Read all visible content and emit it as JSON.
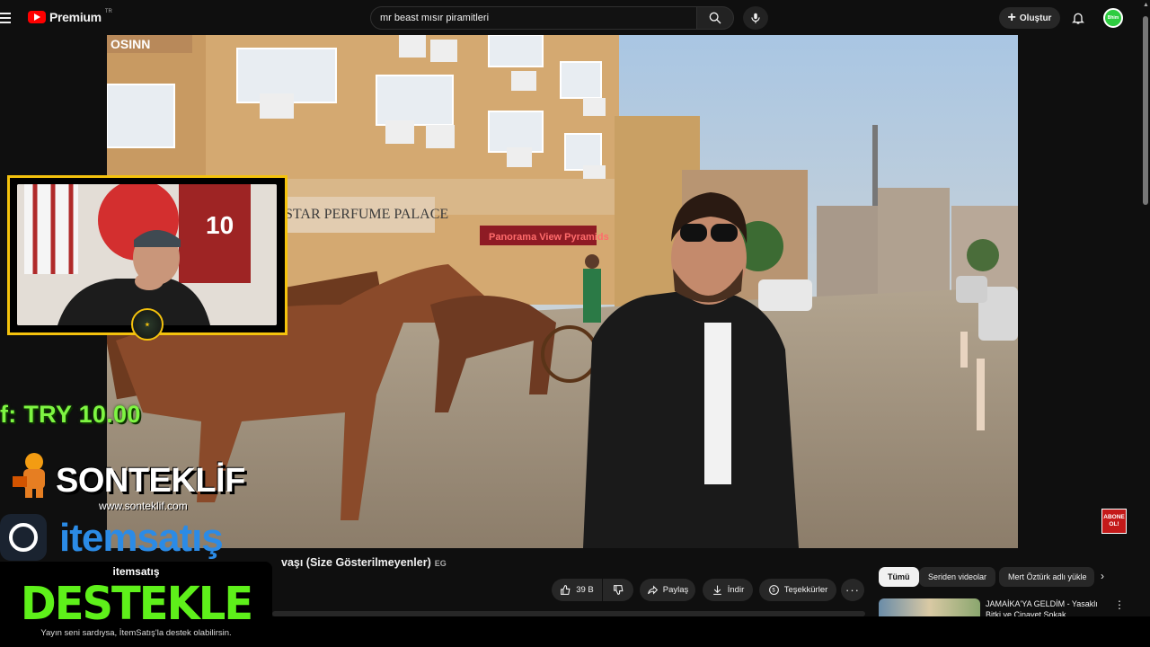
{
  "header": {
    "logo_text": "Premium",
    "logo_region": "TR",
    "search_value": "mr beast mısır piramitleri",
    "create_label": "Oluştur",
    "avatar_text": "Bhim"
  },
  "video": {
    "scene_signs": [
      "OSINN",
      "STAR PERFUME PALACE",
      "Panorama View Pyramids"
    ],
    "title_visible": "vaşı (Size Gösterilmeyenler)",
    "country_tag": "EG",
    "subscribe_badge": "ABONE OL!"
  },
  "actions": {
    "likes": "39 B",
    "share": "Paylaş",
    "download": "İndir",
    "thanks": "Teşekkürler"
  },
  "chips": [
    "Tümü",
    "Seriden videolar",
    "Mert Öztürk adlı yükle"
  ],
  "recommendation": {
    "title": "JAMAİKA'YA GELDİM - Yasaklı Bitki ve Cinayet Sokak..."
  },
  "overlay": {
    "donation": "f: TRY 10.00",
    "brand": "SONTEKLİF",
    "brand_url": "www.sonteklif.com",
    "sponsor": "itemsatış",
    "support_brand": "itemsatış",
    "support_cta": "DESTEKLE",
    "support_sub": "Yayın seni sardıysa, İtemSatış'la destek olabilirsin."
  },
  "colors": {
    "accent_red": "#ff0000",
    "overlay_gold": "#f4c20d",
    "donation_green": "#7ef542",
    "sponsor_blue": "#2b8be6"
  }
}
